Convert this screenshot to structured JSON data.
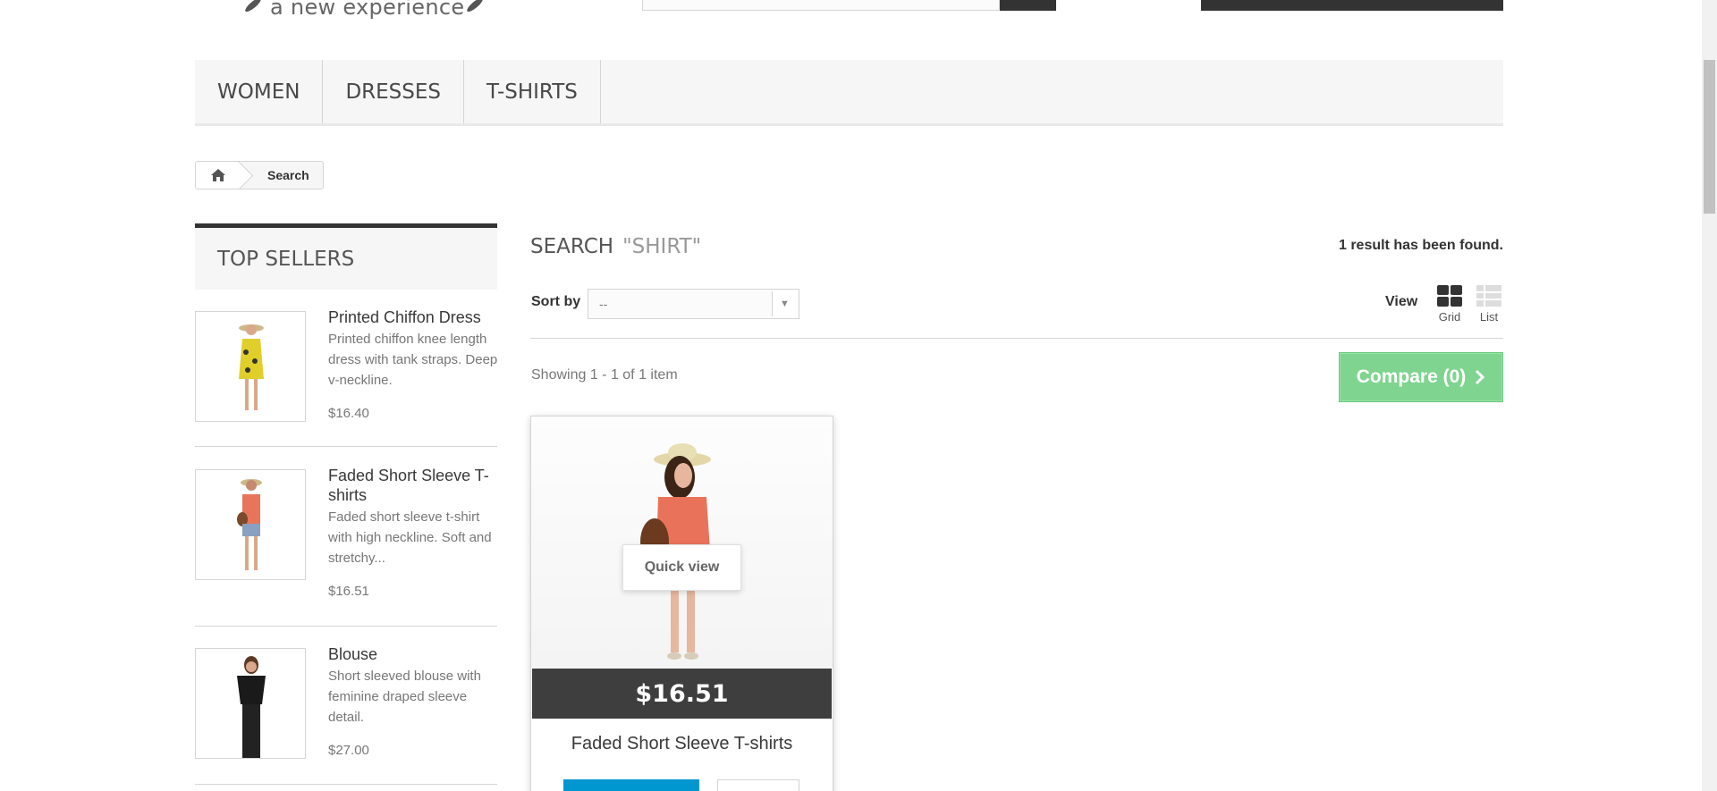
{
  "header": {
    "tagline": "a new experience"
  },
  "nav": {
    "items": [
      "WOMEN",
      "DRESSES",
      "T-SHIRTS"
    ]
  },
  "breadcrumb": {
    "current": "Search"
  },
  "top_sellers": {
    "title": "TOP SELLERS",
    "items": [
      {
        "name": "Printed Chiffon Dress",
        "desc": "Printed chiffon knee length dress with tank straps. Deep v-neckline.",
        "price": "$16.40"
      },
      {
        "name": "Faded Short Sleeve T-shirts",
        "desc": "Faded short sleeve t-shirt with high neckline. Soft and stretchy...",
        "price": "$16.51"
      },
      {
        "name": "Blouse",
        "desc": "Short sleeved blouse with feminine draped sleeve detail.",
        "price": "$27.00"
      }
    ]
  },
  "search": {
    "title": "SEARCH",
    "query": "\"SHIRT\"",
    "result_count": "1 result has been found.",
    "sort_label": "Sort by",
    "sort_value": "--",
    "view_label": "View",
    "view_grid": "Grid",
    "view_list": "List",
    "showing": "Showing 1 - 1 of 1 item",
    "compare": "Compare (0)"
  },
  "product": {
    "name": "Faded Short Sleeve T-shirts",
    "price": "$16.51",
    "quick_view": "Quick view"
  },
  "colors": {
    "accent_dark": "#333333",
    "compare_green": "#7fd58f",
    "cart_blue": "#0097d1"
  }
}
